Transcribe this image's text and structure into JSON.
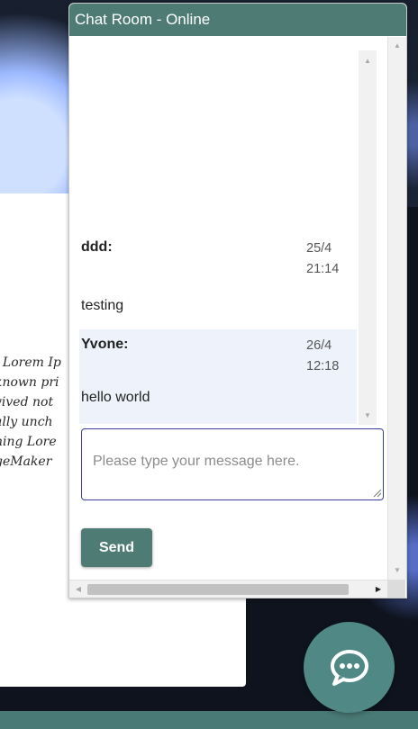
{
  "chat": {
    "title": "Chat Room - Online",
    "input_placeholder": "Please type your message here.",
    "send_label": "Send",
    "messages": [
      {
        "sender": "ddd:",
        "date": "25/4",
        "time": "21:14",
        "text": "testing"
      },
      {
        "sender": "Yvone:",
        "date": "26/4",
        "time": "12:18",
        "text": "hello world"
      }
    ]
  },
  "background": {
    "lorem_lines": [
      ". Lorem Ip",
      "known pri",
      "vived not",
      "ally unch",
      "ning Lore",
      "geMaker"
    ]
  },
  "colors": {
    "header": "#4e7c75",
    "send_button": "#4e7c75",
    "fab": "#4f8884",
    "input_border": "#3b3f9a",
    "highlight_row": "#eef3fb"
  },
  "icons": {
    "fab": "chat-bubble-icon"
  }
}
